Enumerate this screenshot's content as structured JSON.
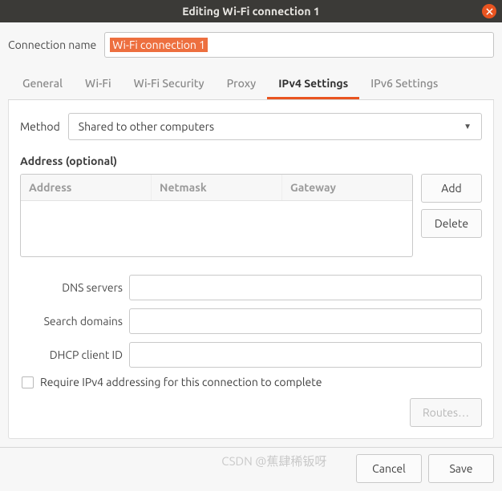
{
  "window": {
    "title": "Editing Wi-Fi connection 1"
  },
  "nameRow": {
    "label": "Connection name",
    "value": "Wi-Fi connection 1"
  },
  "tabs": [
    {
      "label": "General"
    },
    {
      "label": "Wi-Fi"
    },
    {
      "label": "Wi-Fi Security"
    },
    {
      "label": "Proxy"
    },
    {
      "label": "IPv4 Settings",
      "active": true
    },
    {
      "label": "IPv6 Settings"
    }
  ],
  "ipv4": {
    "methodLabel": "Method",
    "methodValue": "Shared to other computers",
    "addressSection": "Address (optional)",
    "columns": {
      "address": "Address",
      "netmask": "Netmask",
      "gateway": "Gateway"
    },
    "buttons": {
      "add": "Add",
      "delete": "Delete",
      "routes": "Routes…"
    },
    "fields": {
      "dnsLabel": "DNS servers",
      "searchLabel": "Search domains",
      "dhcpLabel": "DHCP client ID",
      "requireLabel": "Require IPv4 addressing for this connection to complete"
    }
  },
  "footer": {
    "cancel": "Cancel",
    "save": "Save"
  },
  "watermark": "CSDN @蕉肆稀钣呀"
}
